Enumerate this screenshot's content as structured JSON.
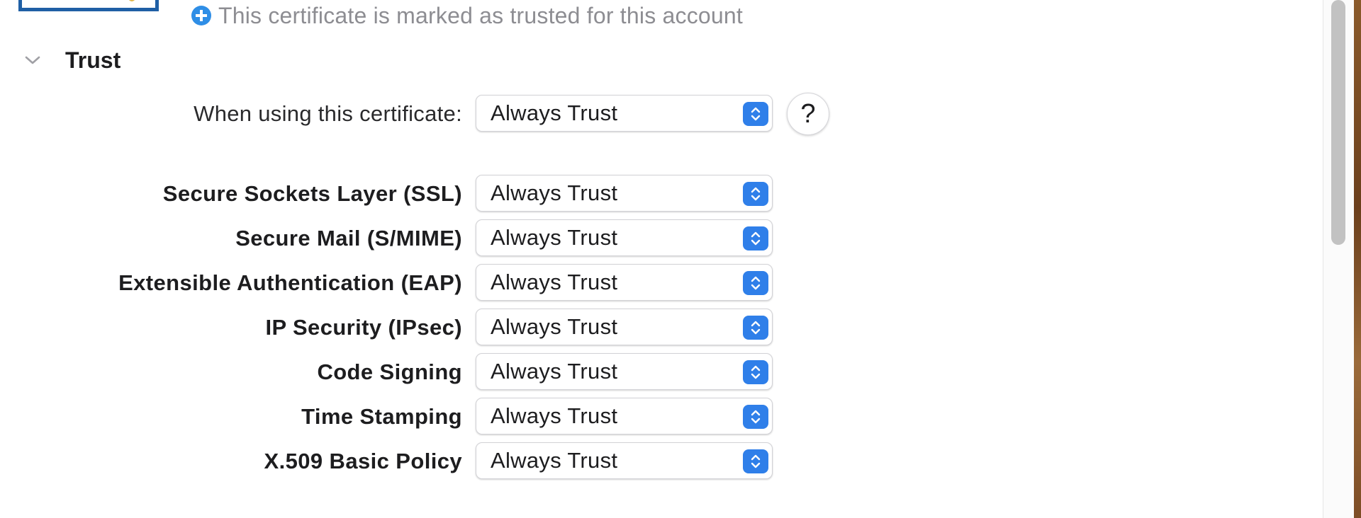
{
  "header": {
    "trust_status_text": "This certificate is marked as trusted for this account",
    "status_icon": "plus-circle-icon",
    "status_icon_color": "#2f8ee6"
  },
  "section": {
    "title": "Trust",
    "expanded": true,
    "toggle_icon": "chevron-down-icon"
  },
  "main_setting": {
    "label": "When using this certificate:",
    "value": "Always Trust",
    "help_label": "?"
  },
  "policies": [
    {
      "label": "Secure Sockets Layer (SSL)",
      "value": "Always Trust"
    },
    {
      "label": "Secure Mail (S/MIME)",
      "value": "Always Trust"
    },
    {
      "label": "Extensible Authentication (EAP)",
      "value": "Always Trust"
    },
    {
      "label": "IP Security (IPsec)",
      "value": "Always Trust"
    },
    {
      "label": "Code Signing",
      "value": "Always Trust"
    },
    {
      "label": "Time Stamping",
      "value": "Always Trust"
    },
    {
      "label": "X.509 Basic Policy",
      "value": "Always Trust"
    }
  ],
  "colors": {
    "accent": "#2f7fe9",
    "cert_frame": "#1f5fa5",
    "secondary_text": "#8d8d92"
  }
}
